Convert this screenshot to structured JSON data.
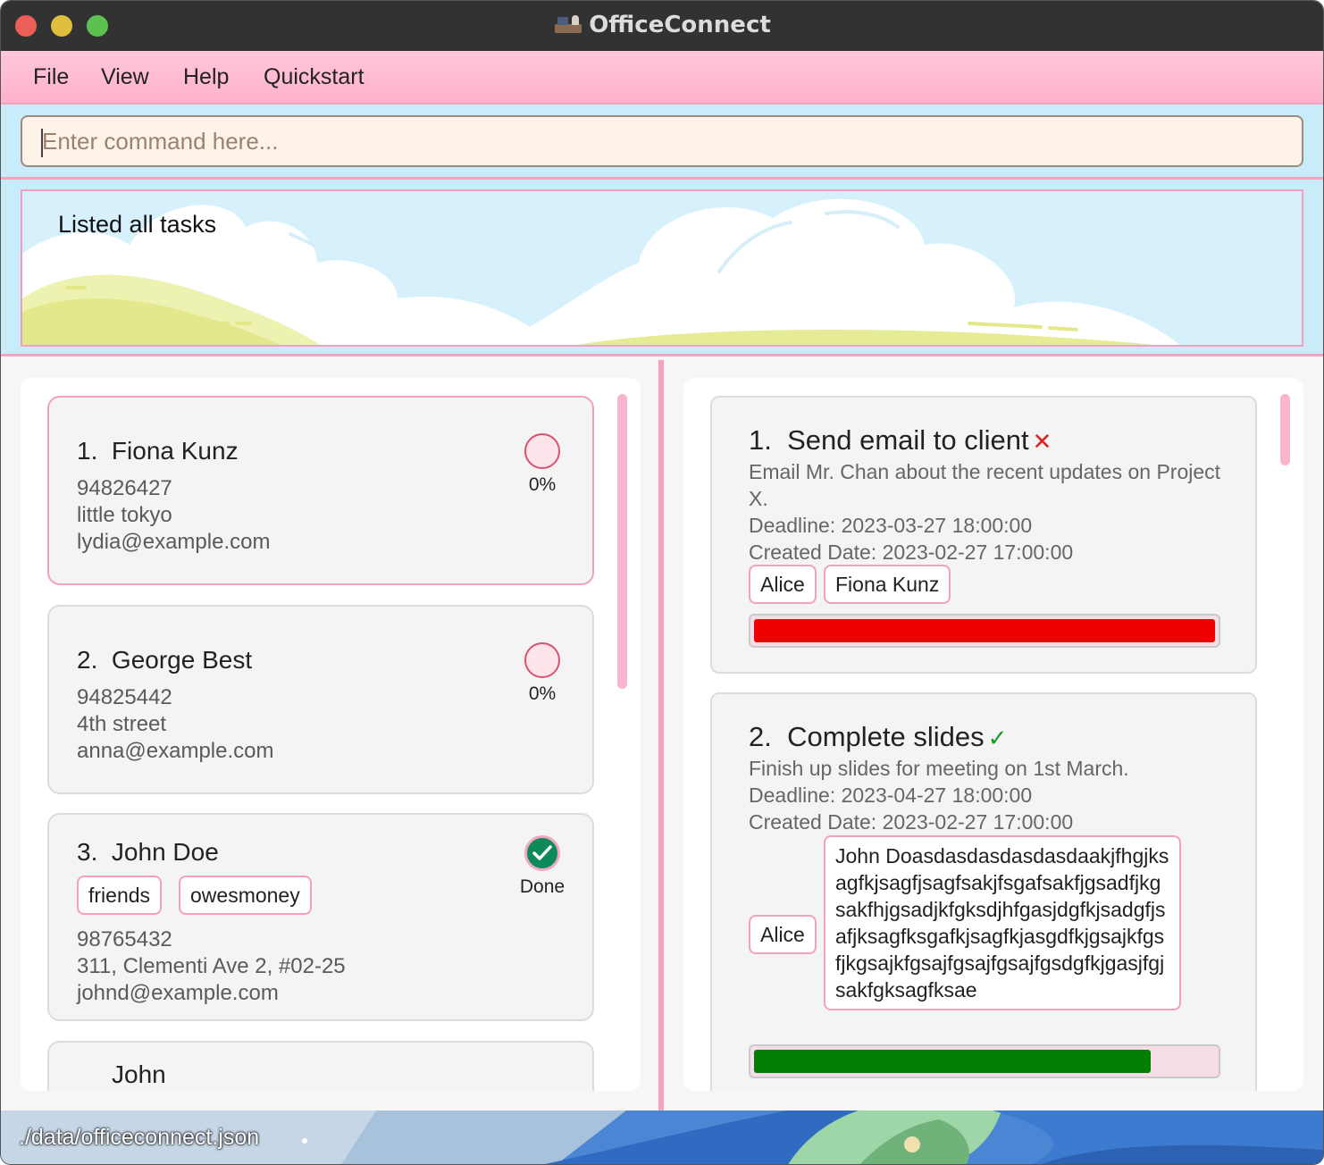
{
  "window": {
    "title": "OfficeConnect"
  },
  "menu": {
    "items": [
      "File",
      "View",
      "Help",
      "Quickstart"
    ]
  },
  "command": {
    "placeholder": "Enter command here...",
    "value": ""
  },
  "result": {
    "message": "Listed all tasks"
  },
  "persons": [
    {
      "index": "1.",
      "name": "Fiona Kunz",
      "phone": "94826427",
      "address": "little tokyo",
      "email": "lydia@example.com",
      "status": "0%",
      "tags": []
    },
    {
      "index": "2.",
      "name": "George Best",
      "phone": "94825442",
      "address": "4th street",
      "email": "anna@example.com",
      "status": "0%",
      "tags": []
    },
    {
      "index": "3.",
      "name": "John Doe",
      "phone": "98765432",
      "address": "311, Clementi Ave 2, #02-25",
      "email": "johnd@example.com",
      "status": "Done",
      "tags": [
        "friends",
        "owesmoney"
      ]
    },
    {
      "index": "",
      "name": "John",
      "phone": "",
      "address": "",
      "email": "",
      "status": "",
      "tags": []
    }
  ],
  "tasks": [
    {
      "index": "1.",
      "title": "Send email to client",
      "mark": "✕",
      "mark_meaning": "not completed",
      "description_line1": "Email Mr. Chan about the recent updates on Project",
      "description_line2": "X.",
      "deadline": "Deadline: 2023-03-27 18:00:00",
      "created": "Created Date: 2023-02-27 17:00:00",
      "assignees": [
        "Alice",
        "Fiona Kunz"
      ],
      "progress": 1.0,
      "progress_color": "#ee0000"
    },
    {
      "index": "2.",
      "title": "Complete slides",
      "mark": "✓",
      "mark_meaning": "completed",
      "description_line1": "Finish up slides for meeting on 1st March.",
      "deadline": "Deadline: 2023-04-27 18:00:00",
      "created": "Created Date: 2023-02-27 17:00:00",
      "assignees": [
        "Alice",
        "John Doasdasdasdasdasdaakjfhgjksagfkjsagfjsagfsakjfsgafsakfjgsadfjkgsakfhjgsadjkfgksdjhfgasjdgfkjsadgfjsafjksagfksgafkjsagfkjasgdfkjgsajkfgsfjkgsajkfgsajfgsajfgsajfgsdgfkjgasjfgjsakfgksagfksae"
      ],
      "progress": 0.86,
      "progress_color": "#047d04"
    }
  ],
  "statusbar": {
    "path": "./data/officeconnect.json"
  },
  "colors": {
    "menu_pink": "#ffb8d2",
    "command_bg": "#c8ecfa",
    "accent_pink": "#f49fc0"
  }
}
